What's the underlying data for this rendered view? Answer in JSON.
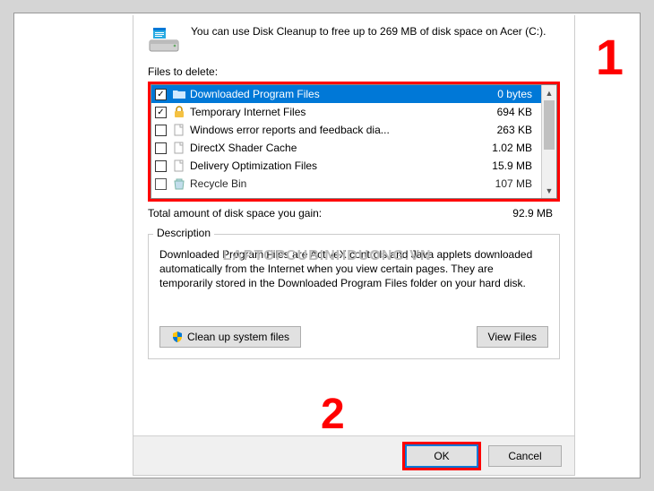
{
  "header": {
    "text": "You can use Disk Cleanup to free up to 269 MB of disk space on Acer (C:)."
  },
  "files_label": "Files to delete:",
  "files": [
    {
      "checked": true,
      "icon": "folder-blue",
      "name": "Downloaded Program Files",
      "size": "0 bytes",
      "selected": true
    },
    {
      "checked": true,
      "icon": "lock",
      "name": "Temporary Internet Files",
      "size": "694 KB",
      "selected": false
    },
    {
      "checked": false,
      "icon": "file",
      "name": "Windows error reports and feedback dia...",
      "size": "263 KB",
      "selected": false
    },
    {
      "checked": false,
      "icon": "file",
      "name": "DirectX Shader Cache",
      "size": "1.02 MB",
      "selected": false
    },
    {
      "checked": false,
      "icon": "file",
      "name": "Delivery Optimization Files",
      "size": "15.9 MB",
      "selected": false
    },
    {
      "checked": false,
      "icon": "recycle",
      "name": "Recycle Bin",
      "size": "107 MB",
      "selected": false
    }
  ],
  "total": {
    "label": "Total amount of disk space you gain:",
    "value": "92.9 MB"
  },
  "description": {
    "label": "Description",
    "text": "Downloaded Program Files are ActiveX controls and Java applets downloaded automatically from the Internet when you view certain pages. They are temporarily stored in the Downloaded Program Files folder on your hard disk."
  },
  "buttons": {
    "cleanup": "Clean up system files",
    "view": "View Files",
    "ok": "OK",
    "cancel": "Cancel"
  },
  "watermark": "LAPTOPCUBINHDUONG.VN",
  "markers": {
    "one": "1",
    "two": "2"
  }
}
